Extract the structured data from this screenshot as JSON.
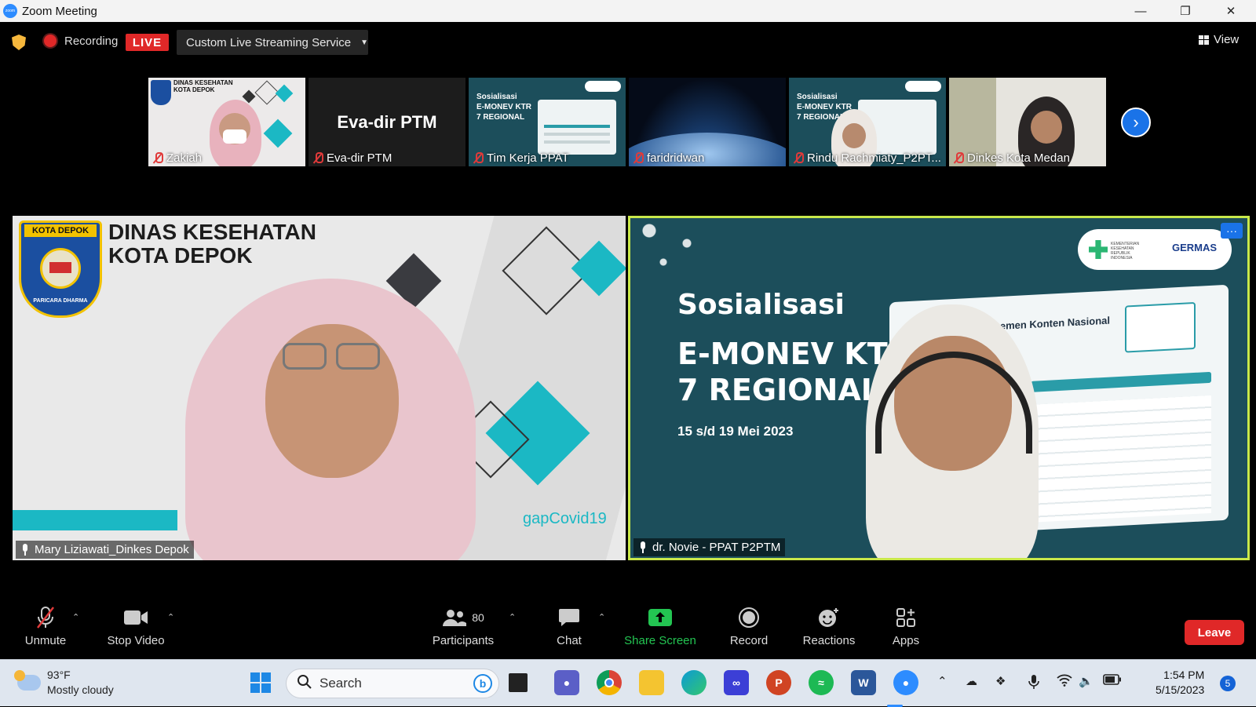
{
  "window": {
    "title": "Zoom Meeting",
    "app_icon_text": "zoom",
    "minimize_icon": "minimize-icon",
    "restore_icon": "restore-icon",
    "close_icon": "close-icon"
  },
  "topbar": {
    "recording_label": "Recording",
    "live_badge": "LIVE",
    "stream_service": "Custom Live Streaming Service",
    "view_label": "View"
  },
  "thumbnails": [
    {
      "name": "Zakiah",
      "muted": true,
      "header": "DINAS KESEHATAN KOTA DEPOK"
    },
    {
      "name": "Eva-dir PTM",
      "muted": true,
      "center_text": "Eva-dir PTM"
    },
    {
      "name": "Tim Kerja PPAT",
      "muted": true,
      "slide_lines": [
        "Sosialisasi",
        "E-MONEV KTR",
        "7 REGIONAL"
      ]
    },
    {
      "name": "faridridwan",
      "muted": true
    },
    {
      "name": "Rindu Rachmiaty_P2PT...",
      "muted": true,
      "slide_lines": [
        "Sosialisasi",
        "E-MONEV KTR",
        "7 REGIONAL"
      ]
    },
    {
      "name": "Dinkes Kota Medan",
      "muted": true
    }
  ],
  "left_tile": {
    "participant": "Mary Liziawati_Dinkes Depok",
    "badge": "KOTA DEPOK",
    "seal_motto": "PARICARA DHARMA",
    "heading_line1": "DINAS KESEHATAN",
    "heading_line2": "KOTA DEPOK",
    "hashtag": "gapCovid19"
  },
  "right_tile": {
    "participant": "dr. Novie - PPAT P2PTM",
    "slide_title": "Sosialisasi",
    "slide_sub1": "E-MONEV KTR",
    "slide_sub2": "7 REGIONAL",
    "slide_date": "15 s/d 19 Mei 2023",
    "logo_text1": "KEMENTERIAN KESEHATAN REPUBLIK INDONESIA",
    "logo_text2": "GERMAS",
    "screen_heading": "...emen Konten Nasional",
    "more_label": "···"
  },
  "toolbar": {
    "unmute": "Unmute",
    "stop_video": "Stop Video",
    "participants": "Participants",
    "participants_count": "80",
    "chat": "Chat",
    "share_screen": "Share Screen",
    "record": "Record",
    "reactions": "Reactions",
    "apps": "Apps",
    "leave": "Leave"
  },
  "taskbar": {
    "temp": "93°F",
    "weather": "Mostly cloudy",
    "search_placeholder": "Search",
    "time": "1:54 PM",
    "date": "5/15/2023",
    "notifications": "5",
    "apps": [
      "windows-start",
      "file-explorer-task",
      "teams",
      "chrome",
      "folder",
      "edge",
      "visual-studio",
      "powerpoint",
      "spotify",
      "word",
      "zoom"
    ]
  },
  "colors": {
    "accent_blue": "#2d8cff",
    "live_red": "#e02828",
    "share_green": "#23c552",
    "active_speaker_border": "#c9e84a",
    "slide_teal": "#1c4e5b",
    "teal_diamond": "#1bb8c4"
  }
}
